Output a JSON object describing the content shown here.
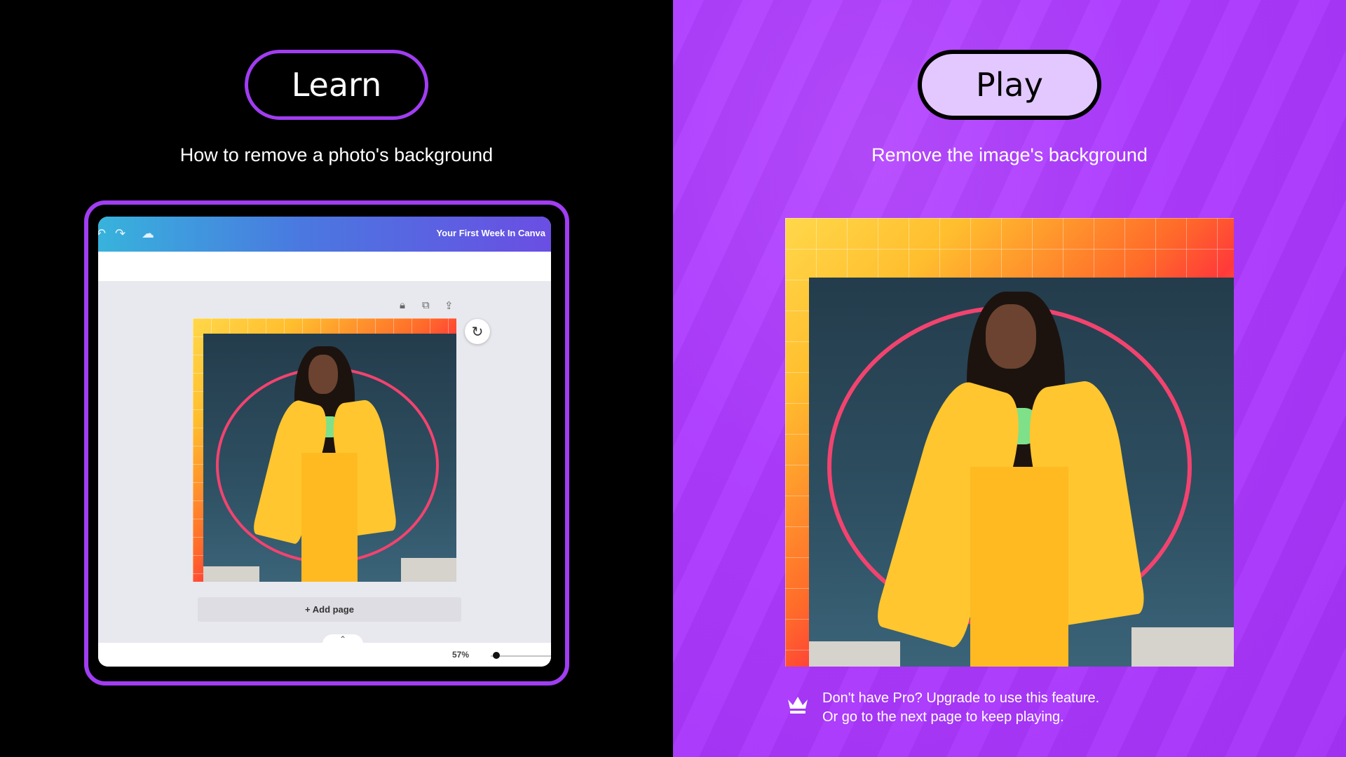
{
  "left": {
    "pill_label": "Learn",
    "subtitle": "How to remove a photo's background",
    "editor": {
      "title": "Your First Week In Canva",
      "add_page_label": "+ Add page",
      "zoom_level": "57%",
      "caret": "⌃"
    }
  },
  "right": {
    "pill_label": "Play",
    "subtitle": "Remove the image's background",
    "notice_line1": "Don't have Pro? Upgrade to use this feature.",
    "notice_line2": "Or go to the next page to keep playing."
  },
  "icons": {
    "undo": "undo-icon",
    "redo": "redo-icon",
    "cloud": "cloud-check-icon",
    "lock": "lock-icon",
    "duplicate": "duplicate-icon",
    "share": "share-icon",
    "refresh": "refresh-icon",
    "crown": "crown-icon"
  },
  "colors": {
    "accent_purple": "#a13df2",
    "play_bg": "#ad3cff",
    "play_pill": "#e3c8ff"
  }
}
